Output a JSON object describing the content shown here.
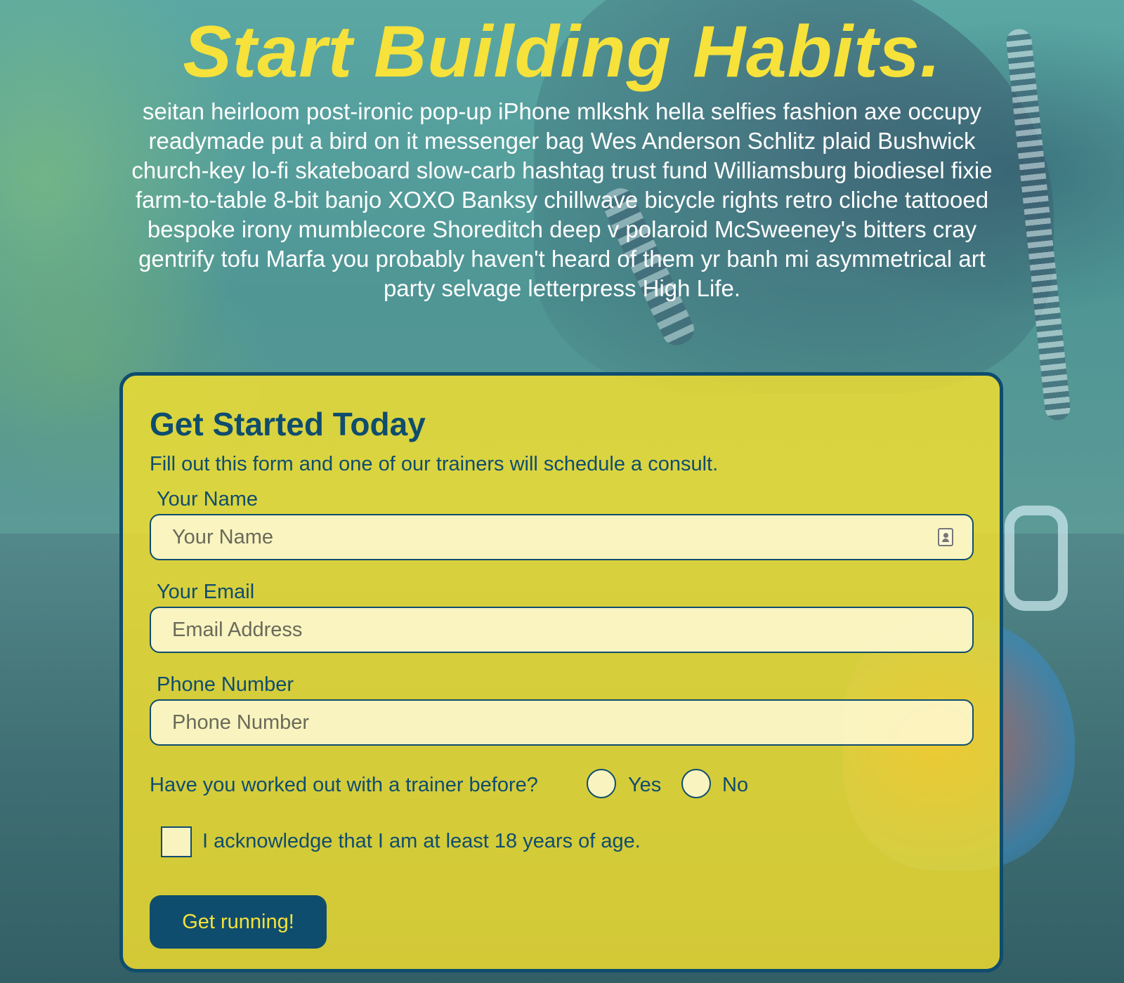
{
  "hero": {
    "title": "Start Building Habits.",
    "text": "seitan heirloom post-ironic pop-up iPhone mlkshk hella selfies fashion axe occupy readymade put a bird on it messenger bag Wes Anderson Schlitz plaid Bushwick church-key lo-fi skateboard slow-carb hashtag trust fund Williamsburg biodiesel fixie farm-to-table 8-bit banjo XOXO Banksy chillwave bicycle rights retro cliche tattooed bespoke irony mumblecore Shoreditch deep v polaroid McSweeney's bitters cray gentrify tofu Marfa you probably haven't heard of them yr banh mi asymmetrical art party selvage letterpress High Life."
  },
  "form": {
    "title": "Get Started Today",
    "subtitle": "Fill out this form and one of our trainers will schedule a consult.",
    "fields": [
      {
        "label": "Your Name",
        "placeholder": "Your Name",
        "value": ""
      },
      {
        "label": "Your Email",
        "placeholder": "Email Address",
        "value": ""
      },
      {
        "label": "Phone Number",
        "placeholder": "Phone Number",
        "value": ""
      }
    ],
    "question": "Have you worked out with a trainer before?",
    "options": [
      "Yes",
      "No"
    ],
    "acknowledge": "I acknowledge that I am at least 18 years of age.",
    "submit_label": "Get running!"
  },
  "icons": {
    "name_field": "contact-card-icon"
  },
  "colors": {
    "accent": "#f6e23a",
    "brand": "#0f4d6e"
  }
}
